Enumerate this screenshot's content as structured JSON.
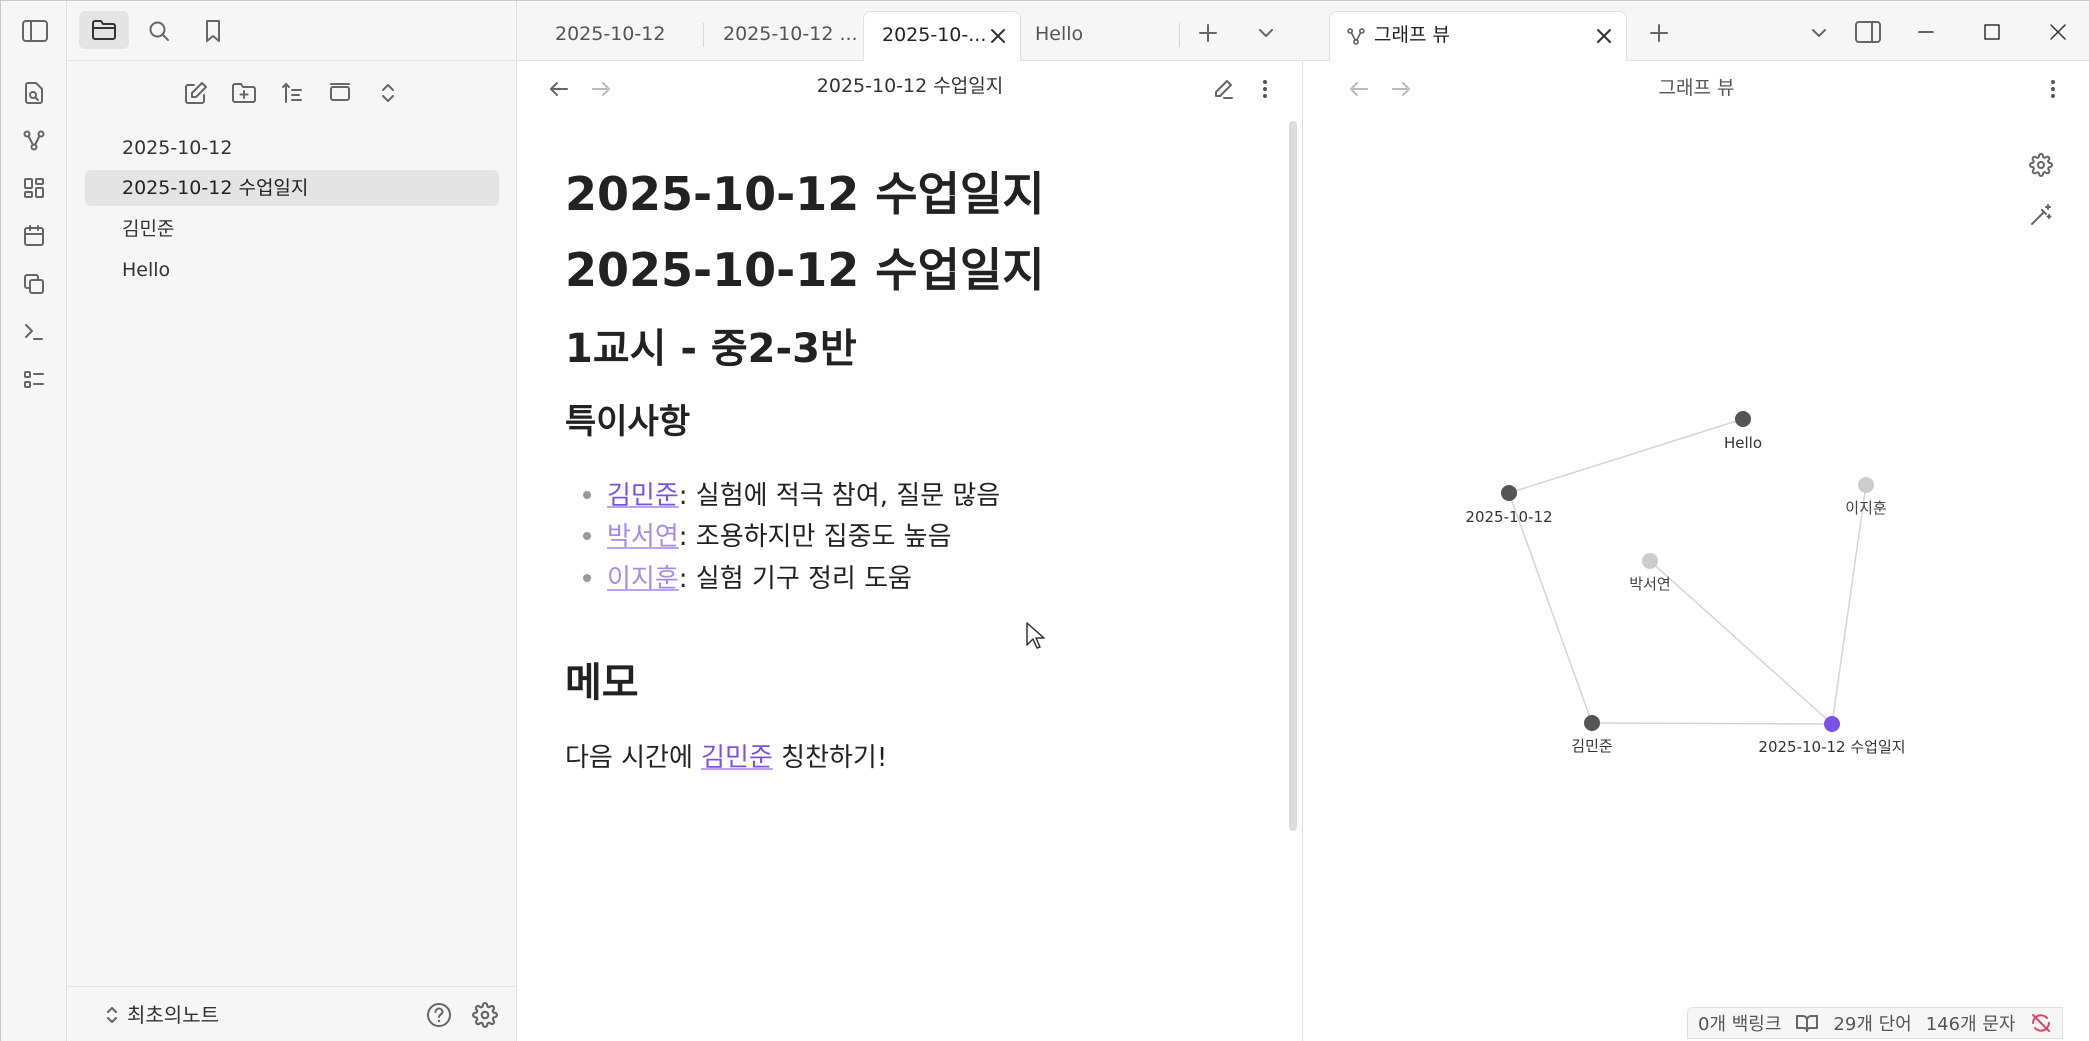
{
  "ribbon": {
    "items": [
      "file-search-icon",
      "graph-icon",
      "dashboard-icon",
      "calendar-icon",
      "copy-icon",
      "terminal-icon",
      "list-icon"
    ]
  },
  "sidebar": {
    "files": [
      {
        "label": "2025-10-12",
        "active": false
      },
      {
        "label": "2025-10-12 수업일지",
        "active": true
      },
      {
        "label": "김민준",
        "active": false
      },
      {
        "label": "Hello",
        "active": false
      }
    ],
    "vault_name": "최초의노트"
  },
  "editor": {
    "tabs": [
      {
        "label": "2025-10-12",
        "active": false
      },
      {
        "label": "2025-10-12 ...",
        "active": false
      },
      {
        "label": "2025-10-...",
        "active": true
      },
      {
        "label": "Hello",
        "active": false
      }
    ],
    "title": "2025-10-12 수업일지",
    "doc": {
      "h1": "2025-10-12 수업일지",
      "h1b": "2025-10-12 수업일지",
      "h2": "1교시 - 중2-3반",
      "h3": "특이사항",
      "bullets": [
        {
          "link": "김민준",
          "text": ": 실험에 적극 참여, 질문 많음"
        },
        {
          "link": "박서연",
          "text": ": 조용하지만 집중도 높음"
        },
        {
          "link": "이지훈",
          "text": ": 실험 기구 정리 도움"
        }
      ],
      "memo_heading": "메모",
      "memo_prefix": "다음 시간에 ",
      "memo_link": "김민준",
      "memo_suffix": " 칭찬하기!"
    }
  },
  "graph": {
    "tab_label": "그래프 뷰",
    "title": "그래프 뷰",
    "nodes": [
      {
        "id": "hello",
        "label": "Hello"
      },
      {
        "id": "d1012",
        "label": "2025-10-12"
      },
      {
        "id": "jihoon",
        "label": "이지훈"
      },
      {
        "id": "seoyeon",
        "label": "박서연"
      },
      {
        "id": "minjun",
        "label": "김민준"
      },
      {
        "id": "journal",
        "label": "2025-10-12 수업일지"
      }
    ],
    "colors": {
      "node": "#555555",
      "faint_node": "#cccccc",
      "active_node": "#7b52e6",
      "edge": "#d4d4d4"
    }
  },
  "status": {
    "backlinks": "0개 백링크",
    "words": "29개 단어",
    "chars": "146개 문자"
  }
}
